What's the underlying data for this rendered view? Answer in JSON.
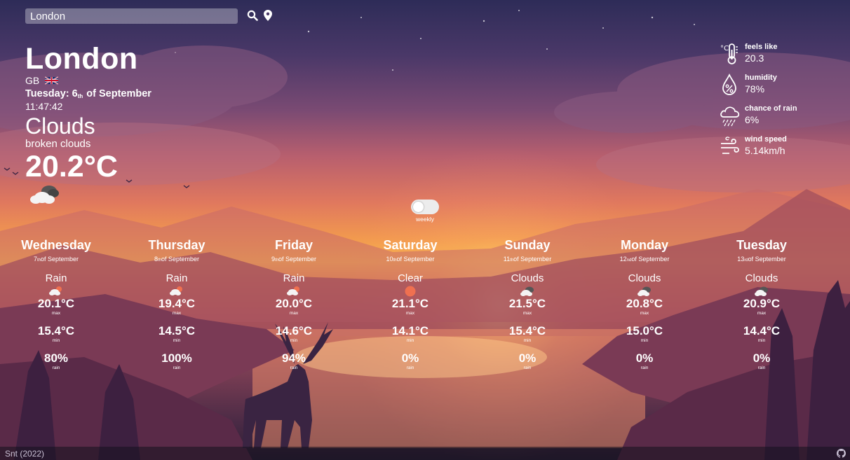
{
  "search": {
    "value": "London",
    "placeholder": ""
  },
  "current": {
    "city": "London",
    "country": "GB",
    "weekday": "Tuesday:",
    "day_num": "6",
    "day_suffix": "th",
    "month_part": "of September",
    "time": "11:47:42",
    "condition": "Clouds",
    "description": "broken clouds",
    "temperature": "20.2°C",
    "icon": "broken-clouds-icon"
  },
  "stats": [
    {
      "label": "feels like",
      "value": "20.3",
      "icon": "thermometer-icon"
    },
    {
      "label": "humidity",
      "value": "78%",
      "icon": "humidity-drop-icon"
    },
    {
      "label": "chance of rain",
      "value": "6%",
      "icon": "rain-cloud-icon"
    },
    {
      "label": "wind speed",
      "value": "5.14km/h",
      "icon": "wind-icon"
    }
  ],
  "toggle": {
    "label": "weekly",
    "on": false
  },
  "forecast_labels": {
    "max": "max",
    "min": "min",
    "rain": "rain"
  },
  "forecast": [
    {
      "day": "Wednesday",
      "num": "7",
      "suffix": "th",
      "month": "of September",
      "condition": "Rain",
      "icon": "rain-icon",
      "max": "20.1°C",
      "min": "15.4°C",
      "rain": "80%"
    },
    {
      "day": "Thursday",
      "num": "8",
      "suffix": "th",
      "month": "of September",
      "condition": "Rain",
      "icon": "rain-icon",
      "max": "19.4°C",
      "min": "14.5°C",
      "rain": "100%"
    },
    {
      "day": "Friday",
      "num": "9",
      "suffix": "th",
      "month": "of September",
      "condition": "Rain",
      "icon": "rain-icon",
      "max": "20.0°C",
      "min": "14.6°C",
      "rain": "94%"
    },
    {
      "day": "Saturday",
      "num": "10",
      "suffix": "th",
      "month": "of September",
      "condition": "Clear",
      "icon": "sun-icon",
      "max": "21.1°C",
      "min": "14.1°C",
      "rain": "0%"
    },
    {
      "day": "Sunday",
      "num": "11",
      "suffix": "th",
      "month": "of September",
      "condition": "Clouds",
      "icon": "clouds-icon",
      "max": "21.5°C",
      "min": "15.4°C",
      "rain": "0%"
    },
    {
      "day": "Monday",
      "num": "12",
      "suffix": "nd",
      "month": "of September",
      "condition": "Clouds",
      "icon": "clouds-icon",
      "max": "20.8°C",
      "min": "15.0°C",
      "rain": "0%"
    },
    {
      "day": "Tuesday",
      "num": "13",
      "suffix": "rd",
      "month": "of September",
      "condition": "Clouds",
      "icon": "clouds-icon",
      "max": "20.9°C",
      "min": "14.4°C",
      "rain": "0%"
    }
  ],
  "footer": {
    "text": "Snt (2022)",
    "link_icon": "github-icon"
  },
  "colors": {
    "accent": "#ffffff",
    "sun": "#f3b23f",
    "clear_icon": "#f07050"
  }
}
